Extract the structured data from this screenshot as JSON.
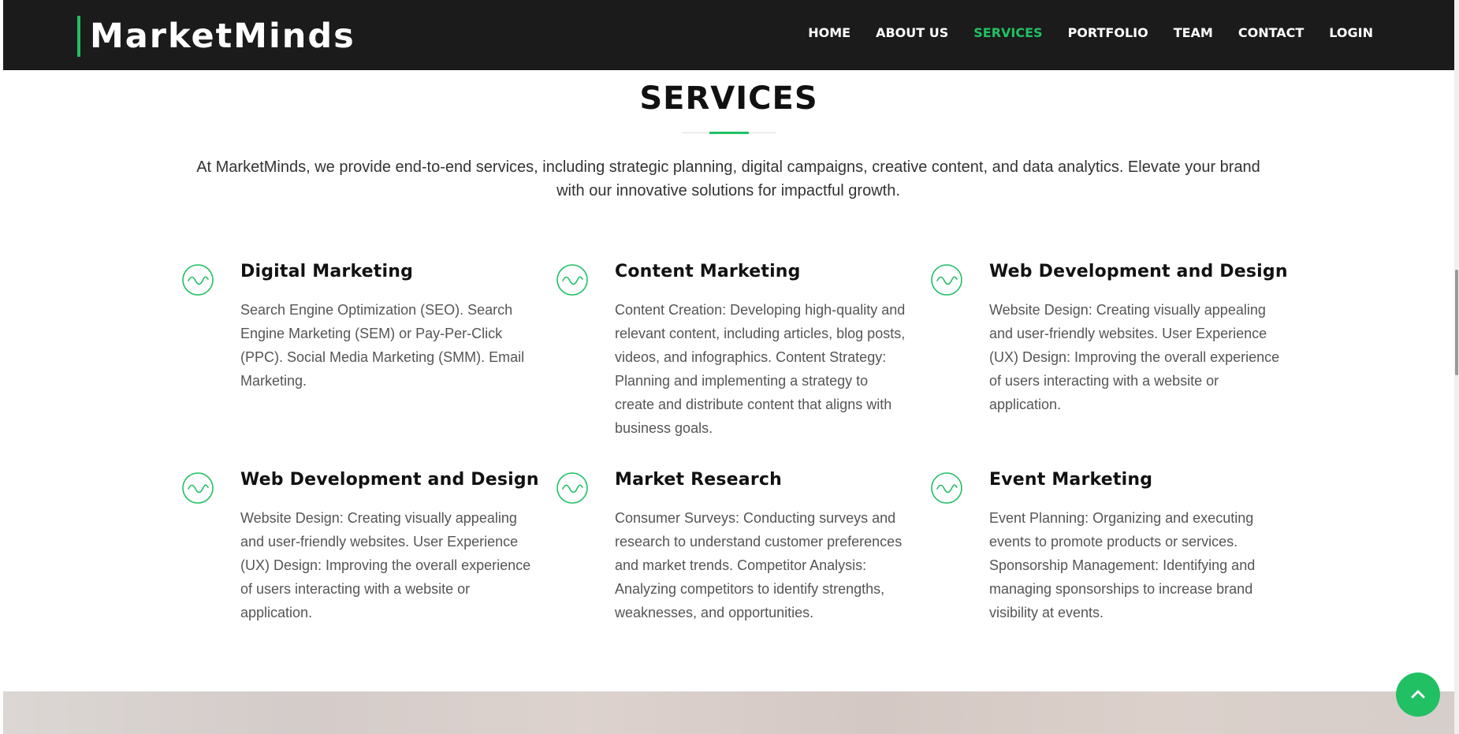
{
  "header": {
    "logo": "MarketMinds",
    "nav": [
      {
        "label": "HOME",
        "active": false
      },
      {
        "label": "ABOUT US",
        "active": false
      },
      {
        "label": "SERVICES",
        "active": true
      },
      {
        "label": "PORTFOLIO",
        "active": false
      },
      {
        "label": "TEAM",
        "active": false
      },
      {
        "label": "CONTACT",
        "active": false
      },
      {
        "label": "LOGIN",
        "active": false
      }
    ]
  },
  "services": {
    "title": "SERVICES",
    "intro": "At MarketMinds, we provide end-to-end services, including strategic planning, digital campaigns, creative content, and data analytics. Elevate your brand with our innovative solutions for impactful growth.",
    "items": [
      {
        "title": "Digital Marketing",
        "description": "Search Engine Optimization (SEO). Search Engine Marketing (SEM) or Pay-Per-Click (PPC). Social Media Marketing (SMM). Email Marketing.",
        "icon": "wave-icon"
      },
      {
        "title": "Content Marketing",
        "description": "Content Creation: Developing high-quality and relevant content, including articles, blog posts, videos, and infographics. Content Strategy: Planning and implementing a strategy to create and distribute content that aligns with business goals.",
        "icon": "wave-icon"
      },
      {
        "title": "Web Development and Design",
        "description": "Website Design: Creating visually appealing and user-friendly websites. User Experience (UX) Design: Improving the overall experience of users interacting with a website or application.",
        "icon": "wave-icon"
      },
      {
        "title": "Web Development and Design",
        "description": "Website Design: Creating visually appealing and user-friendly websites. User Experience (UX) Design: Improving the overall experience of users interacting with a website or application.",
        "icon": "wave-icon"
      },
      {
        "title": "Market Research",
        "description": "Consumer Surveys: Conducting surveys and research to understand customer preferences and market trends. Competitor Analysis: Analyzing competitors to identify strengths, weaknesses, and opportunities.",
        "icon": "wave-icon"
      },
      {
        "title": "Event Marketing",
        "description": "Event Planning: Organizing and executing events to promote products or services. Sponsorship Management: Identifying and managing sponsorships to increase brand visibility at events.",
        "icon": "wave-icon"
      }
    ]
  },
  "colors": {
    "accent": "#21c063",
    "header_bg": "#1b1b1b",
    "text_dark": "#111111",
    "text_body": "#555555"
  },
  "scroll_top": {
    "icon": "chevron-up-icon"
  }
}
